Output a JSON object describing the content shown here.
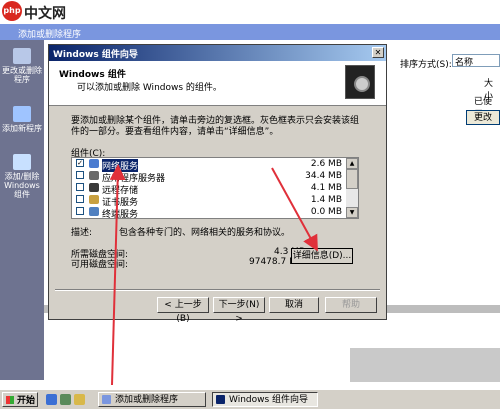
{
  "watermark": {
    "logo": "php",
    "text": "中文网"
  },
  "background_window": {
    "title": "添加或删除程序",
    "nav": [
      {
        "label": "更改或删除程序"
      },
      {
        "label": "添加新程序"
      },
      {
        "label": "添加/删除 Windows 组件"
      }
    ],
    "sort_label": "排序方式(S):",
    "sort_value": "名称",
    "size_label": "大小",
    "used_label": "已使用",
    "change_button": "更改"
  },
  "wizard": {
    "title": "Windows 组件向导",
    "close_glyph": "✕",
    "header_title": "Windows 组件",
    "header_subtitle": "可以添加或删除 Windows 的组件。",
    "instructions": "要添加或删除某个组件，请单击旁边的复选框。灰色框表示只会安装该组件的一部分。要查看组件内容，请单击“详细信息”。",
    "components_label": "组件(C):",
    "components": [
      {
        "name": "网络服务",
        "size": "2.6 MB",
        "checked": true,
        "selected": true,
        "icon_color": "#4a7bd0"
      },
      {
        "name": "应用程序服务器",
        "size": "34.4 MB",
        "checked": false,
        "selected": false,
        "icon_color": "#6a6a6a"
      },
      {
        "name": "远程存储",
        "size": "4.1 MB",
        "checked": false,
        "selected": false,
        "icon_color": "#3a3a3a"
      },
      {
        "name": "证书服务",
        "size": "1.4 MB",
        "checked": false,
        "selected": false,
        "icon_color": "#c8a040"
      },
      {
        "name": "终端服务",
        "size": "0.0 MB",
        "checked": false,
        "selected": false,
        "icon_color": "#5080c0"
      }
    ],
    "description_label": "描述:",
    "description_text": "包含各种专门的、网络相关的服务和协议。",
    "disk_needed_label": "所需磁盘空间:",
    "disk_needed_value": "4.3 MB",
    "disk_available_label": "可用磁盘空间:",
    "disk_available_value": "97478.7 MB",
    "details_button": "详细信息(D)...",
    "back_button": "< 上一步(B)",
    "next_button": "下一步(N) >",
    "cancel_button": "取消",
    "help_button": "帮助"
  },
  "taskbar": {
    "start_label": "开始",
    "tasks": [
      {
        "label": "添加或删除程序"
      },
      {
        "label": "Windows 组件向导"
      }
    ]
  },
  "colors": {
    "titlebar_start": "#0a246a",
    "titlebar_end": "#a6caf0",
    "dialog_face": "#d4d0c8",
    "annotation_red": "#e0303a",
    "selection": "#0a246a"
  }
}
